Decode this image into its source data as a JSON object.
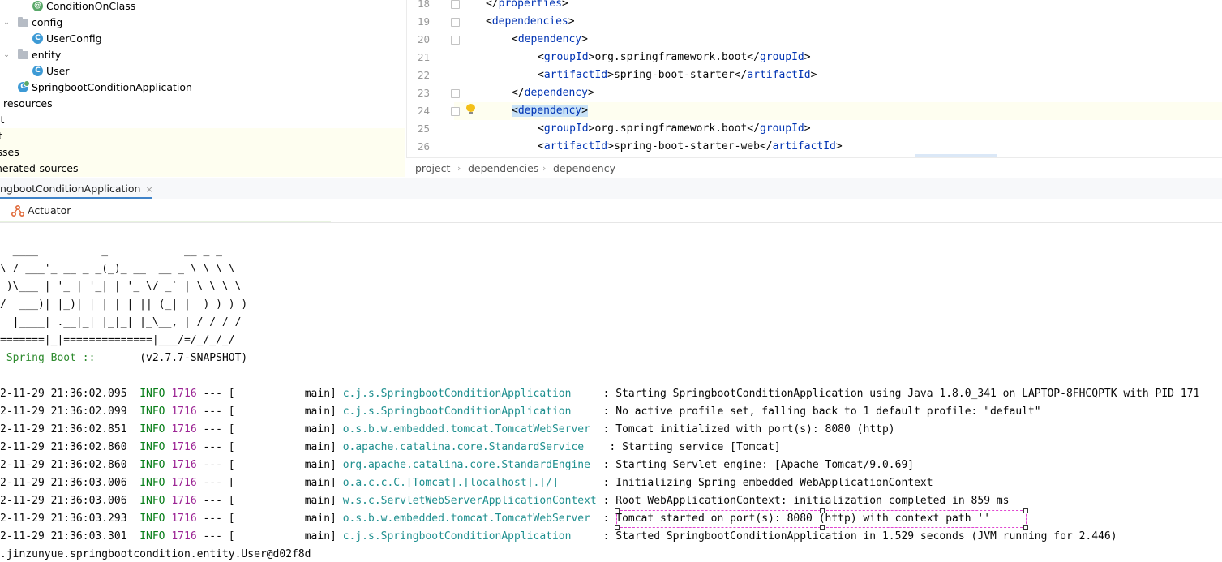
{
  "tree": {
    "items": [
      {
        "label": "ConditionOnClass",
        "icon": "annotation-icon"
      },
      {
        "label": "config",
        "icon": "folder-icon"
      },
      {
        "label": "UserConfig",
        "icon": "class-icon"
      },
      {
        "label": "entity",
        "icon": "folder-icon"
      },
      {
        "label": "User",
        "icon": "class-icon"
      },
      {
        "label": "SpringbootConditionApplication",
        "icon": "spring-app-icon"
      },
      {
        "label": "resources",
        "icon": "none"
      },
      {
        "label": "st",
        "icon": "none"
      },
      {
        "label": "t",
        "icon": "none"
      },
      {
        "label": "isses",
        "icon": "none"
      },
      {
        "label": "nerated-sources",
        "icon": "none"
      }
    ]
  },
  "editor": {
    "line_numbers": [
      "18",
      "19",
      "20",
      "21",
      "22",
      "23",
      "24",
      "25",
      "26"
    ],
    "lines": [
      {
        "open": "</",
        "tag": "properties",
        "close": ">"
      },
      {
        "open": "<",
        "tag": "dependencies",
        "close": ">"
      },
      {
        "open": "<",
        "tag": "dependency",
        "close": ">"
      },
      {
        "open": "<",
        "tag": "groupId",
        "close": ">",
        "text": "org.springframework.boot",
        "end_tag": "groupId"
      },
      {
        "open": "<",
        "tag": "artifactId",
        "close": ">",
        "text": "spring-boot-starter",
        "end_tag": "artifactId"
      },
      {
        "open": "</",
        "tag": "dependency",
        "close": ">"
      },
      {
        "open": "<",
        "tag": "dependency",
        "close": ">"
      },
      {
        "open": "<",
        "tag": "groupId",
        "close": ">",
        "text": "org.springframework.boot",
        "end_tag": "groupId"
      },
      {
        "open": "<",
        "tag": "artifactId",
        "close": ">",
        "text": "spring-boot-starter-web",
        "end_tag": "artifactId"
      }
    ]
  },
  "breadcrumb": [
    "project",
    "dependencies",
    "dependency"
  ],
  "run": {
    "tab_label": "ngbootConditionApplication",
    "tab_close": "×",
    "subtab_label": "Actuator"
  },
  "console": {
    "banner": [
      "  ____          _            __ _ _",
      "\\ / ___'_ __ _ _(_)_ __  __ _ \\ \\ \\ \\",
      " )\\___ | '_ | '_| | '_ \\/ _` | \\ \\ \\ \\",
      "/  ___)| |_)| | | | | || (_| |  ) ) ) )",
      "  |____| .__|_| |_|_| |_\\__, | / / / /",
      "=======|_|==============|___/=/_/_/_/"
    ],
    "spring_label": " Spring Boot ::",
    "spring_version": "       (v2.7.7-SNAPSHOT)",
    "logs": [
      {
        "ts": "2-11-29 21:36:02.095",
        "level": "INFO",
        "pid": "1716",
        "sep": " --- [",
        "thread": "           main]",
        "logger": "c.j.s.SpringbootConditionApplication    ",
        "msg": " : Starting SpringbootConditionApplication using Java 1.8.0_341 on LAPTOP-8FHCQPTK with PID 171"
      },
      {
        "ts": "2-11-29 21:36:02.099",
        "level": "INFO",
        "pid": "1716",
        "sep": " --- [",
        "thread": "           main]",
        "logger": "c.j.s.SpringbootConditionApplication    ",
        "msg": " : No active profile set, falling back to 1 default profile: \"default\""
      },
      {
        "ts": "2-11-29 21:36:02.851",
        "level": "INFO",
        "pid": "1716",
        "sep": " --- [",
        "thread": "           main]",
        "logger": "o.s.b.w.embedded.tomcat.TomcatWebServer ",
        "msg": " : Tomcat initialized with port(s): 8080 (http)"
      },
      {
        "ts": "2-11-29 21:36:02.860",
        "level": "INFO",
        "pid": "1716",
        "sep": " --- [",
        "thread": "           main]",
        "logger": "o.apache.catalina.core.StandardService   ",
        "msg": " : Starting service [Tomcat]"
      },
      {
        "ts": "2-11-29 21:36:02.860",
        "level": "INFO",
        "pid": "1716",
        "sep": " --- [",
        "thread": "           main]",
        "logger": "org.apache.catalina.core.StandardEngine ",
        "msg": " : Starting Servlet engine: [Apache Tomcat/9.0.69]"
      },
      {
        "ts": "2-11-29 21:36:03.006",
        "level": "INFO",
        "pid": "1716",
        "sep": " --- [",
        "thread": "           main]",
        "logger": "o.a.c.c.C.[Tomcat].[localhost].[/]      ",
        "msg": " : Initializing Spring embedded WebApplicationContext"
      },
      {
        "ts": "2-11-29 21:36:03.006",
        "level": "INFO",
        "pid": "1716",
        "sep": " --- [",
        "thread": "           main]",
        "logger": "w.s.c.ServletWebServerApplicationContext",
        "msg": " : Root WebApplicationContext: initialization completed in 859 ms"
      },
      {
        "ts": "2-11-29 21:36:03.293",
        "level": "INFO",
        "pid": "1716",
        "sep": " --- [",
        "thread": "           main]",
        "logger": "o.s.b.w.embedded.tomcat.TomcatWebServer ",
        "msg": " : Tomcat started on port(s): 8080 (http) with context path ''"
      },
      {
        "ts": "2-11-29 21:36:03.301",
        "level": "INFO",
        "pid": "1716",
        "sep": " --- [",
        "thread": "           main]",
        "logger": "c.j.s.SpringbootConditionApplication    ",
        "msg": " : Started SpringbootConditionApplication in 1.529 seconds (JVM running for 2.446)"
      }
    ],
    "last_line": ".jinzunyue.springbootcondition.entity.User@d02f8d"
  }
}
